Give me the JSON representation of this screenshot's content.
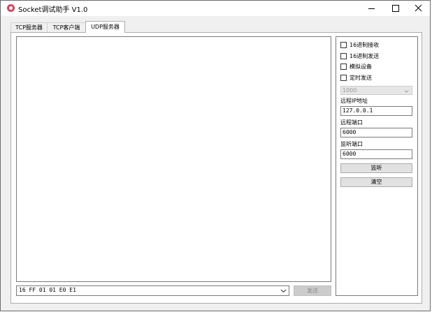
{
  "window": {
    "title": "Socket调试助手 V1.0"
  },
  "tabs": [
    {
      "label": "TCP服务器"
    },
    {
      "label": "TCP客户端"
    },
    {
      "label": "UDP服务器",
      "selected": true
    }
  ],
  "send": {
    "value": "16 FF 01 01 E0 E1",
    "button_label": "发送"
  },
  "options": {
    "hex_receive": {
      "label": "16进制接收",
      "checked": false
    },
    "hex_send": {
      "label": "16进制发送",
      "checked": false
    },
    "simulate_device": {
      "label": "模拟设备",
      "checked": false
    },
    "timed_send": {
      "label": "定时发送",
      "checked": false
    },
    "interval": "1000"
  },
  "remote_ip": {
    "label": "远程IP地址",
    "value": "127.0.0.1"
  },
  "remote_port": {
    "label": "远程端口",
    "value": "6000"
  },
  "listen_port": {
    "label": "监听端口",
    "value": "6000"
  },
  "buttons": {
    "listen": "监听",
    "clear": "清空"
  },
  "icons": {
    "app": "app-logo-icon",
    "minimize": "minimize-icon",
    "maximize": "maximize-icon",
    "close": "close-icon",
    "dropdown": "chevron-down-icon"
  }
}
